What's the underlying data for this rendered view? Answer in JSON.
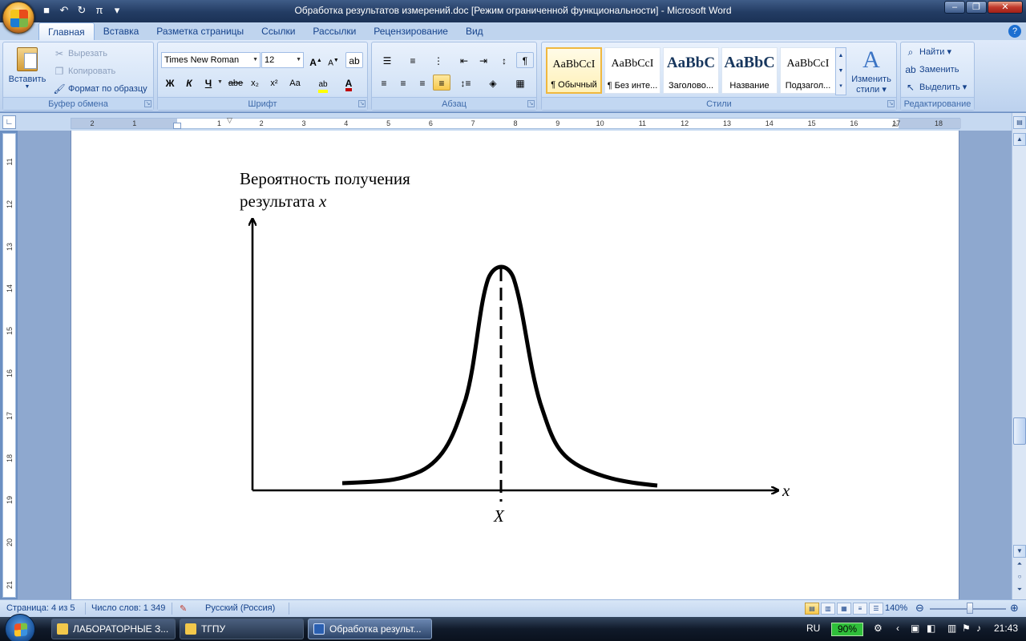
{
  "window": {
    "title": "Обработка результатов измерений.doc [Режим ограниченной функциональности] - Microsoft Word"
  },
  "tabs": [
    "Главная",
    "Вставка",
    "Разметка страницы",
    "Ссылки",
    "Рассылки",
    "Рецензирование",
    "Вид"
  ],
  "ribbon": {
    "clipboard": {
      "label": "Буфер обмена",
      "paste": "Вставить",
      "cut": "Вырезать",
      "copy": "Копировать",
      "format_painter": "Формат по образцу"
    },
    "font": {
      "label": "Шрифт",
      "font_name": "Times New Roman",
      "font_size": "12",
      "bold": "Ж",
      "italic": "К",
      "underline": "Ч",
      "strike": "abe",
      "subscript": "x₂",
      "superscript": "x²",
      "change_case": "Aa"
    },
    "paragraph": {
      "label": "Абзац"
    },
    "styles": {
      "label": "Стили",
      "items": [
        {
          "preview": "AaBbCcI",
          "name": "¶ Обычный"
        },
        {
          "preview": "AaBbCcI",
          "name": "¶ Без инте..."
        },
        {
          "preview": "AaBbC",
          "name": "Заголово..."
        },
        {
          "preview": "AaBbC",
          "name": "Название"
        },
        {
          "preview": "AaBbCcI",
          "name": "Подзагол..."
        }
      ],
      "change_styles_line1": "Изменить",
      "change_styles_line2": "стили"
    },
    "editing": {
      "label": "Редактирование",
      "find": "Найти",
      "replace": "Заменить",
      "select": "Выделить"
    }
  },
  "ruler": {
    "numbers": [
      "2",
      "1",
      "",
      "1",
      "2",
      "3",
      "4",
      "5",
      "6",
      "7",
      "8",
      "9",
      "10",
      "11",
      "12",
      "13",
      "14",
      "15",
      "16",
      "17",
      "18"
    ],
    "vertical_numbers": [
      "11",
      "12",
      "13",
      "14",
      "15",
      "16",
      "17",
      "18",
      "19",
      "20",
      "21"
    ]
  },
  "figure": {
    "y_label_line1": "Вероятность получения",
    "y_label_line2_text": "результата ",
    "y_label_line2_var": "x",
    "x_axis_var": "x",
    "center_label": "X"
  },
  "status": {
    "page": "Страница: 4 из 5",
    "words": "Число слов: 1 349",
    "language": "Русский (Россия)",
    "zoom": "140%"
  },
  "taskbar": {
    "tasks": [
      "ЛАБОРАТОРНЫЕ З...",
      "ТГПУ",
      "Обработка результ..."
    ],
    "lang": "RU",
    "battery": "90%",
    "clock": "21:43"
  }
}
